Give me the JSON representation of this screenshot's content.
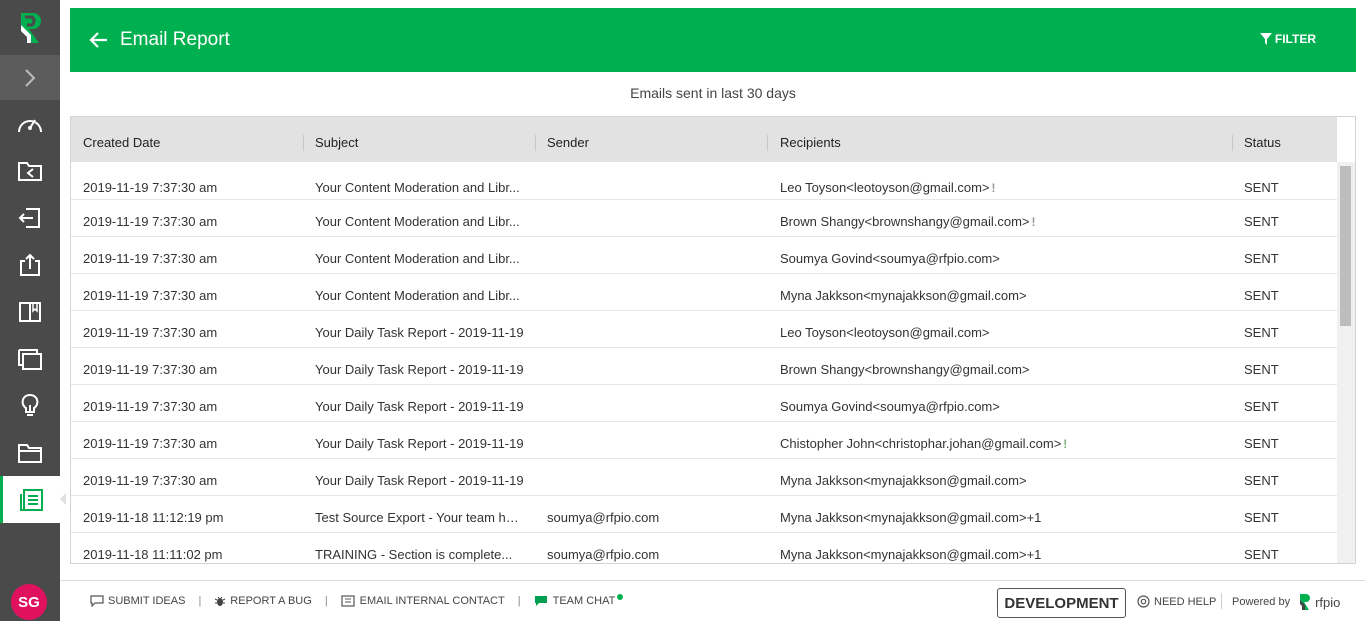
{
  "header": {
    "title": "Email Report",
    "filter_label": "FILTER"
  },
  "subtitle": "Emails sent in last 30 days",
  "table": {
    "columns": [
      "Created Date",
      "Subject",
      "Sender",
      "Recipients",
      "Status"
    ],
    "rows": [
      {
        "date": "2019-11-19 7:37:30 am",
        "subject": "Your Content Moderation and Libr...",
        "sender": "",
        "recipients": "Leo Toyson<leotoyson@gmail.com>",
        "warn": true,
        "status": "SENT"
      },
      {
        "date": "2019-11-19 7:37:30 am",
        "subject": "Your Content Moderation and Libr...",
        "sender": "",
        "recipients": "Brown Shangy<brownshangy@gmail.com>",
        "warn": true,
        "status": "SENT"
      },
      {
        "date": "2019-11-19 7:37:30 am",
        "subject": "Your Content Moderation and Libr...",
        "sender": "",
        "recipients": "Soumya Govind<soumya@rfpio.com>",
        "warn": false,
        "status": "SENT"
      },
      {
        "date": "2019-11-19 7:37:30 am",
        "subject": "Your Content Moderation and Libr...",
        "sender": "",
        "recipients": "Myna Jakkson<mynajakkson@gmail.com>",
        "warn": false,
        "status": "SENT"
      },
      {
        "date": "2019-11-19 7:37:30 am",
        "subject": "Your Daily Task Report - 2019-11-19",
        "sender": "",
        "recipients": "Leo Toyson<leotoyson@gmail.com>",
        "warn": false,
        "status": "SENT"
      },
      {
        "date": "2019-11-19 7:37:30 am",
        "subject": "Your Daily Task Report - 2019-11-19",
        "sender": "",
        "recipients": "Brown Shangy<brownshangy@gmail.com>",
        "warn": false,
        "status": "SENT"
      },
      {
        "date": "2019-11-19 7:37:30 am",
        "subject": "Your Daily Task Report - 2019-11-19",
        "sender": "",
        "recipients": "Soumya Govind<soumya@rfpio.com>",
        "warn": false,
        "status": "SENT"
      },
      {
        "date": "2019-11-19 7:37:30 am",
        "subject": "Your Daily Task Report - 2019-11-19",
        "sender": "",
        "recipients": "Chistopher John<christophar.johan@gmail.com>",
        "warn": true,
        "status": "SENT"
      },
      {
        "date": "2019-11-19 7:37:30 am",
        "subject": "Your Daily Task Report - 2019-11-19",
        "sender": "",
        "recipients": "Myna Jakkson<mynajakkson@gmail.com>",
        "warn": false,
        "status": "SENT"
      },
      {
        "date": "2019-11-18 11:12:19 pm",
        "subject": "Test Source Export - Your team has...",
        "sender": "soumya@rfpio.com",
        "recipients": "Myna Jakkson<mynajakkson@gmail.com>+1",
        "warn": false,
        "status": "SENT"
      },
      {
        "date": "2019-11-18 11:11:02 pm",
        "subject": "TRAINING - Section is complete...",
        "sender": "soumya@rfpio.com",
        "recipients": "Myna Jakkson<mynajakkson@gmail.com>+1",
        "warn": false,
        "status": "SENT"
      }
    ]
  },
  "footer": {
    "submit_ideas": "SUBMIT IDEAS",
    "report_bug": "REPORT A BUG",
    "email_contact": "EMAIL INTERNAL CONTACT",
    "team_chat": "TEAM CHAT",
    "environment": "DEVELOPMENT",
    "need_help": "NEED HELP",
    "powered_by": "Powered by",
    "brand": "rfpio"
  },
  "user": {
    "initials": "SG"
  },
  "colors": {
    "accent": "#00b050",
    "sidebar": "#4a4a4a",
    "avatar": "#e0115f"
  },
  "sidebar_icons": [
    "dashboard-icon",
    "projects-icon",
    "import-icon",
    "export-icon",
    "library-icon",
    "collections-icon",
    "ideas-icon",
    "folder-icon",
    "reports-icon"
  ]
}
